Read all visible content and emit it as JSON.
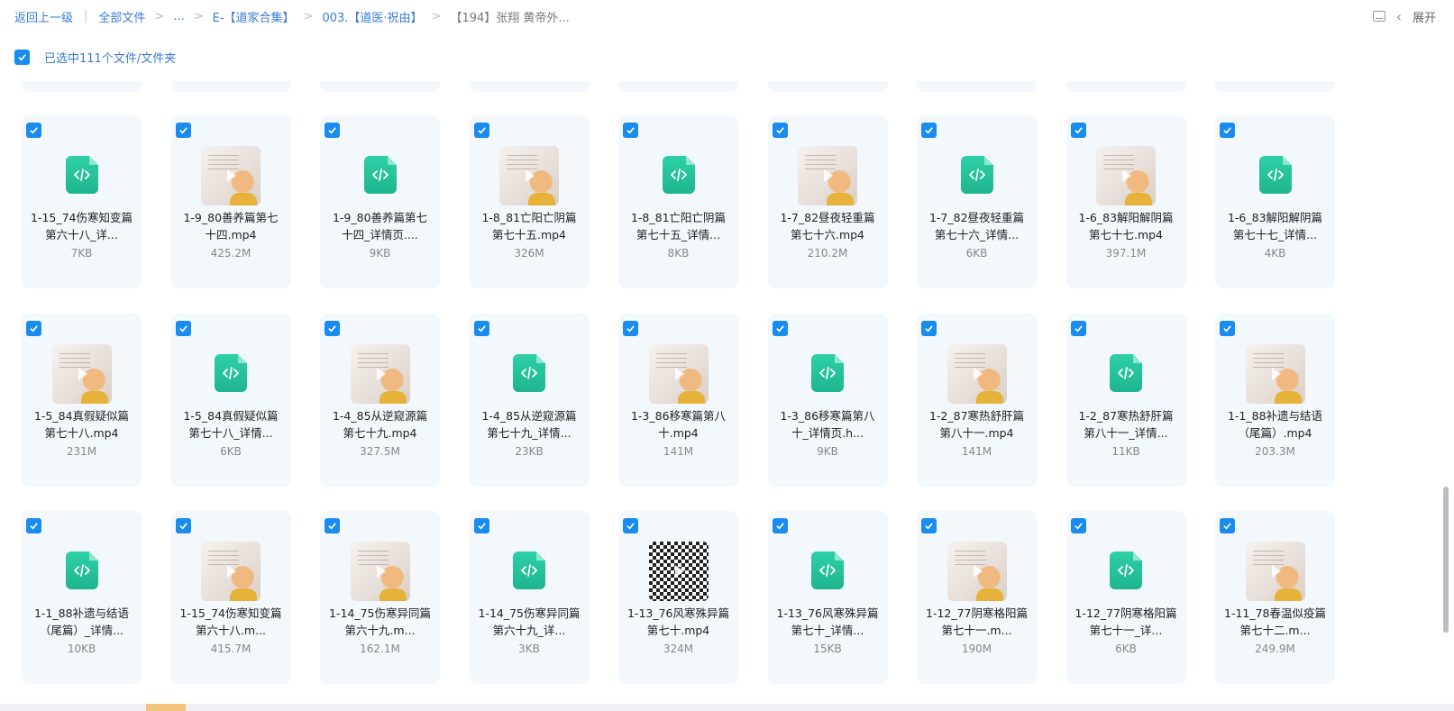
{
  "breadcrumb": {
    "back": "返回上一级",
    "all_files": "全部文件",
    "ellipsis": "...",
    "folder1": "E-【道家合集】",
    "folder2": "003.【道医·祝由】",
    "current": "【194】张翔 黄帝外..."
  },
  "toolbar": {
    "expand": "展开"
  },
  "selection": {
    "text": "已选中111个文件/文件夹"
  },
  "rows": [
    [
      {
        "name": "1-15_74伤寒知变篇第六十八_详...",
        "size": "7KB",
        "type": "code"
      },
      {
        "name": "1-9_80善养篇第七十四.mp4",
        "size": "425.2M",
        "type": "video"
      },
      {
        "name": "1-9_80善养篇第七十四_详情页....",
        "size": "9KB",
        "type": "code"
      },
      {
        "name": "1-8_81亡阳亡阴篇第七十五.mp4",
        "size": "326M",
        "type": "video"
      },
      {
        "name": "1-8_81亡阳亡阴篇第七十五_详情...",
        "size": "8KB",
        "type": "code"
      },
      {
        "name": "1-7_82昼夜轻重篇第七十六.mp4",
        "size": "210.2M",
        "type": "video"
      },
      {
        "name": "1-7_82昼夜轻重篇第七十六_详情...",
        "size": "6KB",
        "type": "code"
      },
      {
        "name": "1-6_83解阳解阴篇第七十七.mp4",
        "size": "397.1M",
        "type": "video"
      },
      {
        "name": "1-6_83解阳解阴篇第七十七_详情...",
        "size": "4KB",
        "type": "code"
      }
    ],
    [
      {
        "name": "1-5_84真假疑似篇第七十八.mp4",
        "size": "231M",
        "type": "video"
      },
      {
        "name": "1-5_84真假疑似篇第七十八_详情...",
        "size": "6KB",
        "type": "code"
      },
      {
        "name": "1-4_85从逆窥源篇第七十九.mp4",
        "size": "327.5M",
        "type": "video"
      },
      {
        "name": "1-4_85从逆窥源篇第七十九_详情...",
        "size": "23KB",
        "type": "code"
      },
      {
        "name": "1-3_86移寒篇第八十.mp4",
        "size": "141M",
        "type": "video"
      },
      {
        "name": "1-3_86移寒篇第八十_详情页.h...",
        "size": "9KB",
        "type": "code"
      },
      {
        "name": "1-2_87寒热舒肝篇第八十一.mp4",
        "size": "141M",
        "type": "video"
      },
      {
        "name": "1-2_87寒热舒肝篇第八十一_详情...",
        "size": "11KB",
        "type": "code"
      },
      {
        "name": "1-1_88补遗与结语（尾篇）.mp4",
        "size": "203.3M",
        "type": "video"
      }
    ],
    [
      {
        "name": "1-1_88补遗与结语（尾篇）_详情...",
        "size": "10KB",
        "type": "code"
      },
      {
        "name": "1-15_74伤寒知变篇第六十八.m...",
        "size": "415.7M",
        "type": "video"
      },
      {
        "name": "1-14_75伤寒异同篇第六十九.m...",
        "size": "162.1M",
        "type": "video"
      },
      {
        "name": "1-14_75伤寒异同篇第六十九_详...",
        "size": "3KB",
        "type": "code"
      },
      {
        "name": "1-13_76风寒殊异篇第七十.mp4",
        "size": "324M",
        "type": "qr"
      },
      {
        "name": "1-13_76风寒殊异篇第七十_详情...",
        "size": "15KB",
        "type": "code"
      },
      {
        "name": "1-12_77阴寒格阳篇第七十一.m...",
        "size": "190M",
        "type": "video"
      },
      {
        "name": "1-12_77阴寒格阳篇第七十一_详...",
        "size": "6KB",
        "type": "code"
      },
      {
        "name": "1-11_78春温似疫篇第七十二.m...",
        "size": "249.9M",
        "type": "video"
      }
    ]
  ]
}
